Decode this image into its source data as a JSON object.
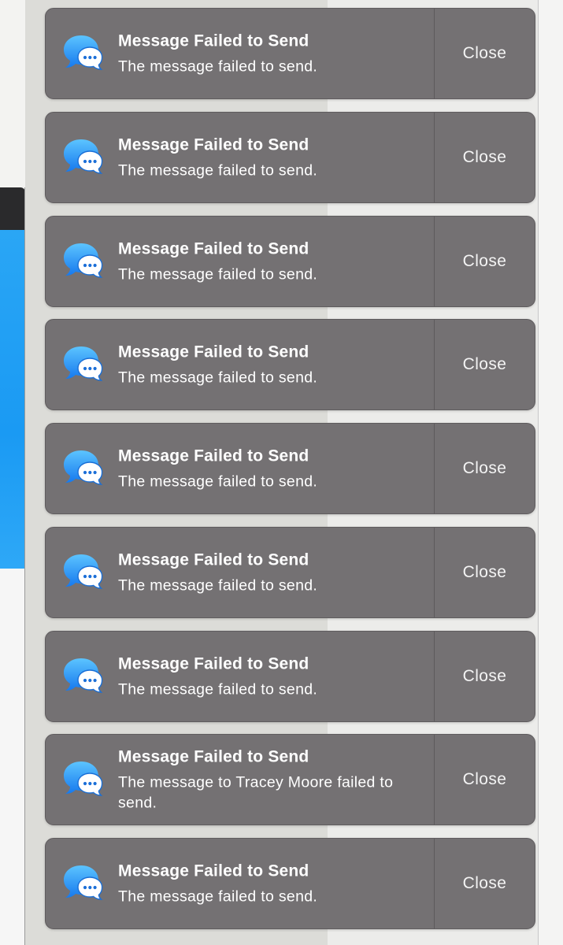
{
  "notifications": [
    {
      "app_icon": "messages-icon",
      "title": "Message Failed to Send",
      "body": "The message failed to send.",
      "close_label": "Close"
    },
    {
      "app_icon": "messages-icon",
      "title": "Message Failed to Send",
      "body": "The message failed to send.",
      "close_label": "Close"
    },
    {
      "app_icon": "messages-icon",
      "title": "Message Failed to Send",
      "body": "The message failed to send.",
      "close_label": "Close"
    },
    {
      "app_icon": "messages-icon",
      "title": "Message Failed to Send",
      "body": "The message failed to send.",
      "close_label": "Close"
    },
    {
      "app_icon": "messages-icon",
      "title": "Message Failed to Send",
      "body": "The message failed to send.",
      "close_label": "Close"
    },
    {
      "app_icon": "messages-icon",
      "title": "Message Failed to Send",
      "body": "The message failed to send.",
      "close_label": "Close"
    },
    {
      "app_icon": "messages-icon",
      "title": "Message Failed to Send",
      "body": "The message failed to send.",
      "close_label": "Close"
    },
    {
      "app_icon": "messages-icon",
      "title": "Message Failed to Send",
      "body": "The message to Tracey Moore failed to send.",
      "close_label": "Close"
    },
    {
      "app_icon": "messages-icon",
      "title": "Message Failed to Send",
      "body": "The message failed to send.",
      "close_label": "Close"
    }
  ],
  "colors": {
    "notification_bg": "#747173",
    "notification_text": "#ffffff",
    "messages_blue": "#2a8ff5",
    "background_window_blue": "#1a9af3"
  }
}
